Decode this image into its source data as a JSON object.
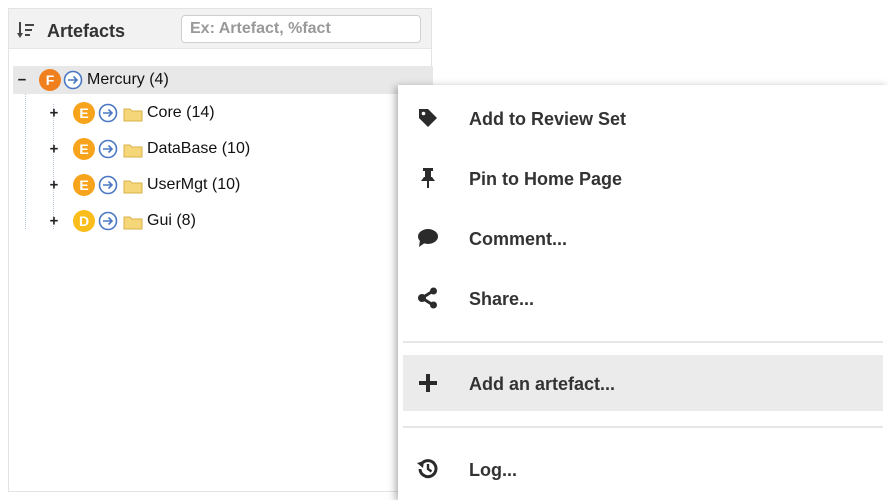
{
  "panel": {
    "title": "Artefacts",
    "search_placeholder": "Ex: Artefact, %fact",
    "sort_icon": "sort-icon"
  },
  "tree": {
    "root": {
      "badge": "F",
      "badge_color": "#f07f1e",
      "label": "Mercury (4)",
      "toggle": "−"
    },
    "children": [
      {
        "badge": "E",
        "badge_color": "#f7a31b",
        "label": "Core (14)",
        "toggle": "+"
      },
      {
        "badge": "E",
        "badge_color": "#f7a31b",
        "label": "DataBase (10)",
        "toggle": "+"
      },
      {
        "badge": "E",
        "badge_color": "#f7a31b",
        "label": "UserMgt (10)",
        "toggle": "+"
      },
      {
        "badge": "D",
        "badge_color": "#fbbd1c",
        "label": "Gui (8)",
        "toggle": "+"
      }
    ]
  },
  "menu": {
    "items": [
      {
        "label": "Add to Review Set",
        "icon": "tag-icon"
      },
      {
        "label": "Pin to Home Page",
        "icon": "pin-icon"
      },
      {
        "label": "Comment...",
        "icon": "comment-icon"
      },
      {
        "label": "Share...",
        "icon": "share-icon"
      },
      {
        "label": "Add an artefact...",
        "icon": "plus-icon",
        "highlighted": true
      },
      {
        "label": "Log...",
        "icon": "history-icon"
      }
    ]
  },
  "colors": {
    "arrow": "#4a78c4",
    "folder": "#f5d679",
    "icon": "#2b2b2b"
  }
}
